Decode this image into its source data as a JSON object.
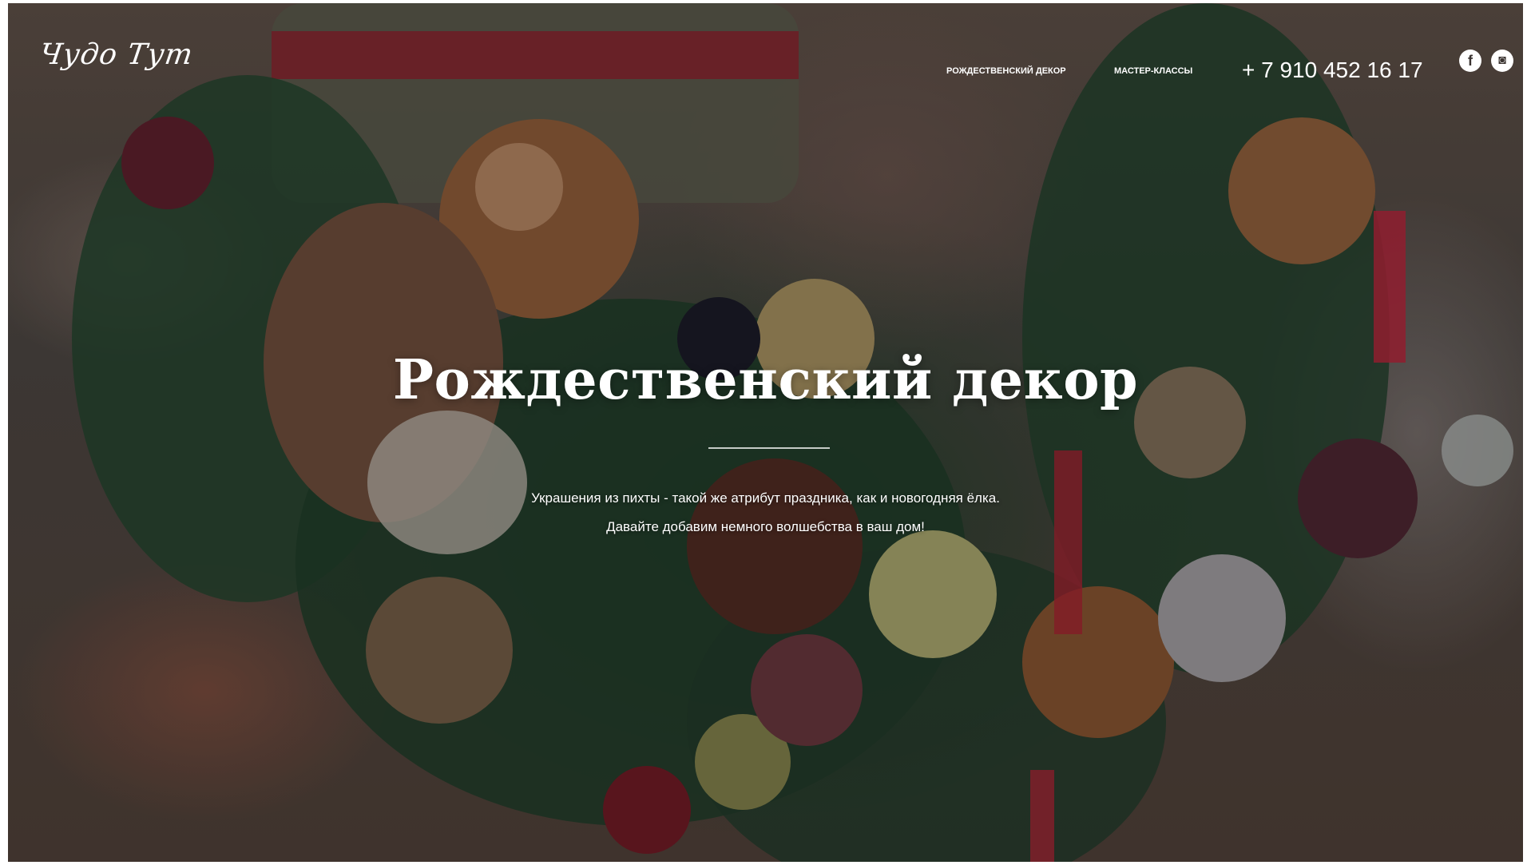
{
  "header": {
    "logo_text": "Чудо Тут",
    "nav": [
      {
        "label": "Рождественский декор"
      },
      {
        "label": "Мастер-классы"
      }
    ],
    "phone": "+ 7 910 452 16 17",
    "social": [
      {
        "icon": "facebook-icon",
        "glyph": "f"
      },
      {
        "icon": "instagram-icon",
        "glyph": "◙"
      }
    ]
  },
  "hero": {
    "title": "Рождественский декор",
    "subtitle_line1": "Украшения из пихты - такой же атрибут праздника, как и новогодняя ёлка.",
    "subtitle_line2": "Давайте добавим немного волшебства в ваш дом!"
  }
}
